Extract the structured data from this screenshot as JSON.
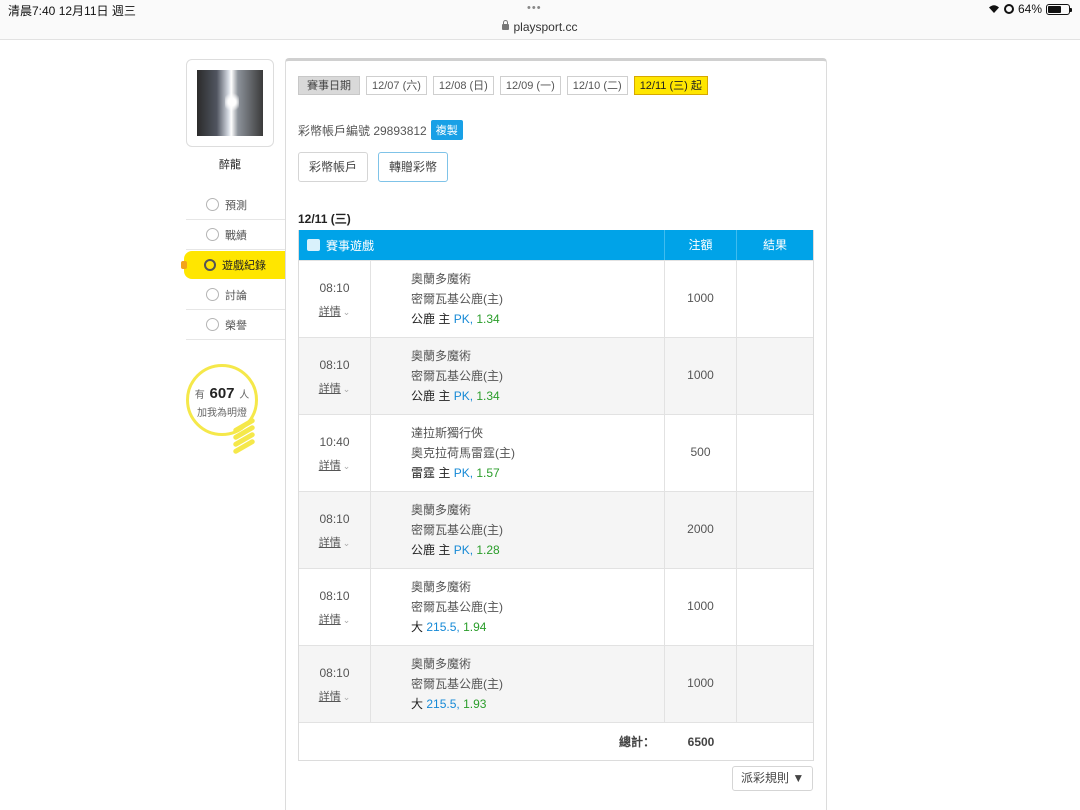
{
  "status_bar": {
    "time_date": "清晨7:40   12月11日 週三",
    "url": "playsport.cc",
    "battery": "64%"
  },
  "profile": {
    "username": "醉龍",
    "lamp_prefix": "有",
    "lamp_count": "607",
    "lamp_suffix": "人",
    "lamp_text": "加我為明燈"
  },
  "nav": [
    {
      "label": "預測",
      "icon": "target-icon"
    },
    {
      "label": "戰績",
      "icon": "badge-icon"
    },
    {
      "label": "遊戲紀錄",
      "icon": "circle-icon",
      "active": true
    },
    {
      "label": "討論",
      "icon": "magnifier-icon"
    },
    {
      "label": "榮譽",
      "icon": "medal-icon"
    }
  ],
  "date_filter": {
    "label": "賽事日期",
    "dates": [
      "12/07 (六)",
      "12/08 (日)",
      "12/09 (一)",
      "12/10 (二)",
      "12/11 (三) 起"
    ],
    "selected": "12/11 (三) 起"
  },
  "account": {
    "label": "彩幣帳戶編號 29893812",
    "copy_label": "複製",
    "btn_account": "彩幣帳戶",
    "btn_transfer": "轉贈彩幣"
  },
  "day_heading": "12/11 (三)",
  "table": {
    "col_game": "賽事遊戲",
    "col_amount": "注額",
    "col_result": "結果",
    "detail_label": "詳情",
    "rows": [
      {
        "time": "08:10",
        "away": "奧蘭多魔術",
        "home": "密爾瓦基公鹿(主)",
        "pick": "公鹿 主",
        "line": "PK,",
        "odds": "1.34",
        "amount": "1000",
        "result": ""
      },
      {
        "time": "08:10",
        "away": "奧蘭多魔術",
        "home": "密爾瓦基公鹿(主)",
        "pick": "公鹿 主",
        "line": "PK,",
        "odds": "1.34",
        "amount": "1000",
        "result": ""
      },
      {
        "time": "10:40",
        "away": "達拉斯獨行俠",
        "home": "奧克拉荷馬雷霆(主)",
        "pick": "雷霆 主",
        "line": "PK,",
        "odds": "1.57",
        "amount": "500",
        "result": ""
      },
      {
        "time": "08:10",
        "away": "奧蘭多魔術",
        "home": "密爾瓦基公鹿(主)",
        "pick": "公鹿 主",
        "line": "PK,",
        "odds": "1.28",
        "amount": "2000",
        "result": ""
      },
      {
        "time": "08:10",
        "away": "奧蘭多魔術",
        "home": "密爾瓦基公鹿(主)",
        "pick": "大",
        "line": "215.5,",
        "odds": "1.94",
        "amount": "1000",
        "result": ""
      },
      {
        "time": "08:10",
        "away": "奧蘭多魔術",
        "home": "密爾瓦基公鹿(主)",
        "pick": "大",
        "line": "215.5,",
        "odds": "1.93",
        "amount": "1000",
        "result": ""
      }
    ],
    "total_label": "總計：",
    "total_value": "6500"
  },
  "rules_button": "派彩規則 ▼",
  "colors": {
    "accent_blue": "#00a3e8",
    "highlight_yellow": "#ffe600",
    "odds_green": "#2a9d2a",
    "line_blue": "#1589d6"
  }
}
